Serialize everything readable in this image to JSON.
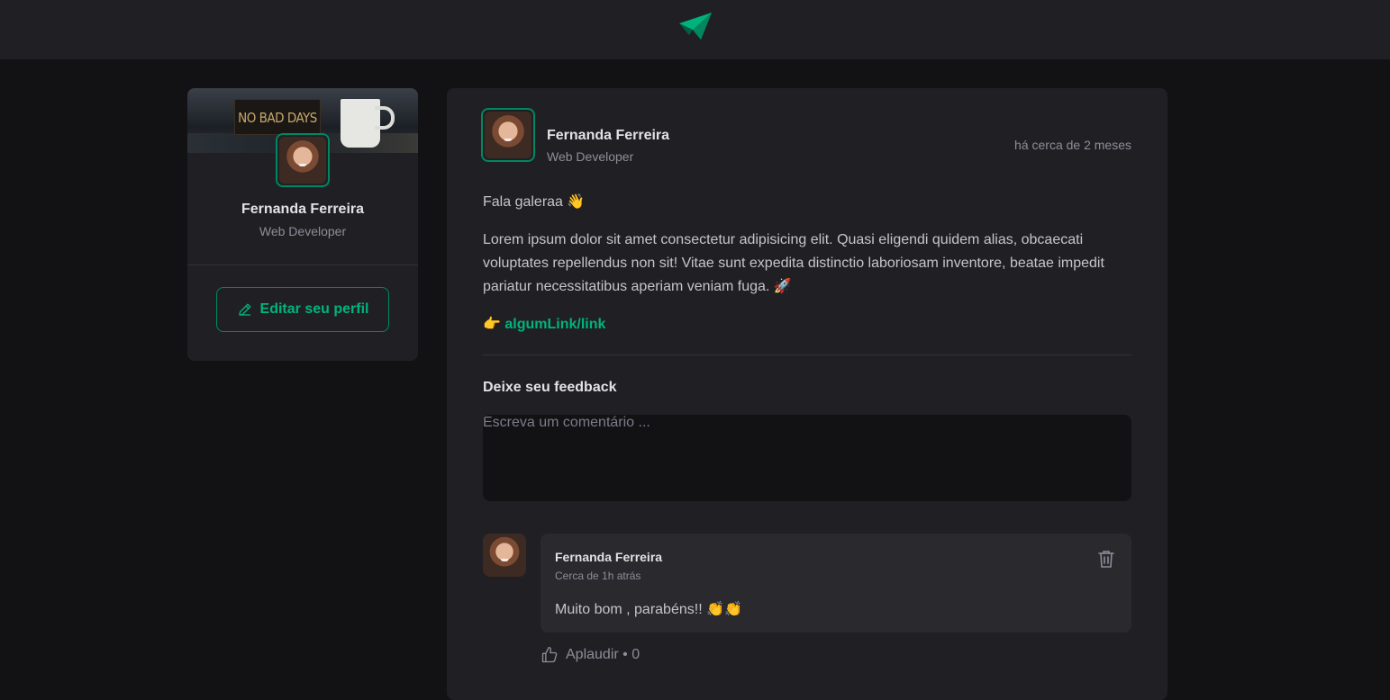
{
  "header": {
    "logo": "paper-plane-logo"
  },
  "sidebar": {
    "cover_sign_text": "NO BAD DAYS",
    "name": "Fernanda Ferreira",
    "role": "Web Developer",
    "edit_label": "Editar seu perfil",
    "edit_icon": "pencil-icon"
  },
  "post": {
    "author": {
      "name": "Fernanda Ferreira",
      "role": "Web Developer"
    },
    "published": "há cerca de 2 meses",
    "content": {
      "greeting": "Fala galeraa 👋",
      "paragraph": "Lorem ipsum dolor sit amet consectetur adipisicing elit. Quasi eligendi quidem alias, obcaecati voluptates repellendus non sit! Vitae sunt expedita distinctio laboriosam inventore, beatae impedit pariatur necessitatibus aperiam veniam fuga. 🚀",
      "link_prefix": "👉",
      "link": "algumLink/link"
    },
    "feedback_title": "Deixe seu feedback",
    "comment_placeholder": "Escreva um comentário ..."
  },
  "comments": [
    {
      "author": "Fernanda Ferreira",
      "time": "Cerca de 1h atrás",
      "text": "Muito bom , parabéns!! 👏👏",
      "applaud_label": "Aplaudir • 0"
    }
  ],
  "colors": {
    "accent": "#00b37e",
    "accent_border": "#00875f",
    "background": "#121214",
    "surface": "#202024"
  }
}
